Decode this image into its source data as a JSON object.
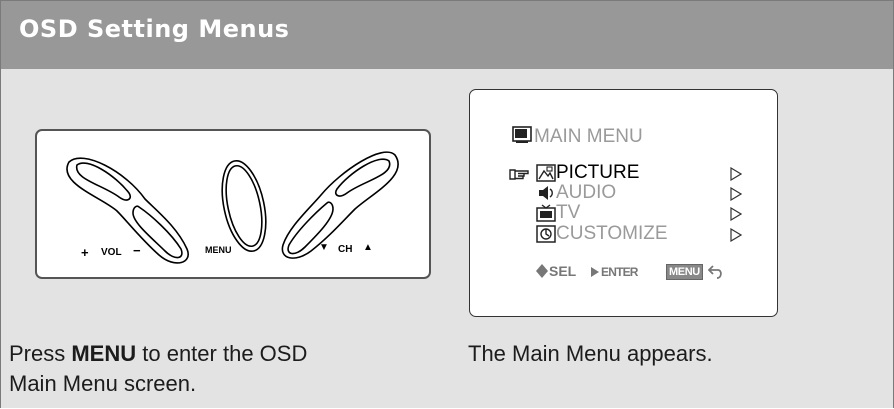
{
  "header": {
    "title": "OSD Setting Menus"
  },
  "remote_panel": {
    "vol_plus": "+",
    "vol_label": "VOL",
    "vol_minus": "−",
    "menu_label": "MENU",
    "ch_down": "▼",
    "ch_label": "CH",
    "ch_up": "▲"
  },
  "osd_screen": {
    "title": "MAIN  MENU",
    "items": [
      {
        "label": "PICTURE",
        "selected": true,
        "icon": "picture-icon"
      },
      {
        "label": "AUDIO",
        "selected": false,
        "icon": "speaker-icon"
      },
      {
        "label": "TV",
        "selected": false,
        "icon": "tv-icon"
      },
      {
        "label": "CUSTOMIZE",
        "selected": false,
        "icon": "customize-icon"
      }
    ],
    "legend": {
      "sel": "SEL",
      "enter": "ENTER",
      "menu": "MENU"
    }
  },
  "captions": {
    "left_prefix": "Press ",
    "left_bold": "MENU",
    "left_suffix": " to enter the OSD",
    "left_line2": "Main Menu screen.",
    "right": "The Main Menu appears."
  },
  "colors": {
    "header_bg": "#989898",
    "body_bg": "#e3e3e3",
    "menu_selected": "#000000",
    "menu_unselected": "#9a9a9a"
  }
}
